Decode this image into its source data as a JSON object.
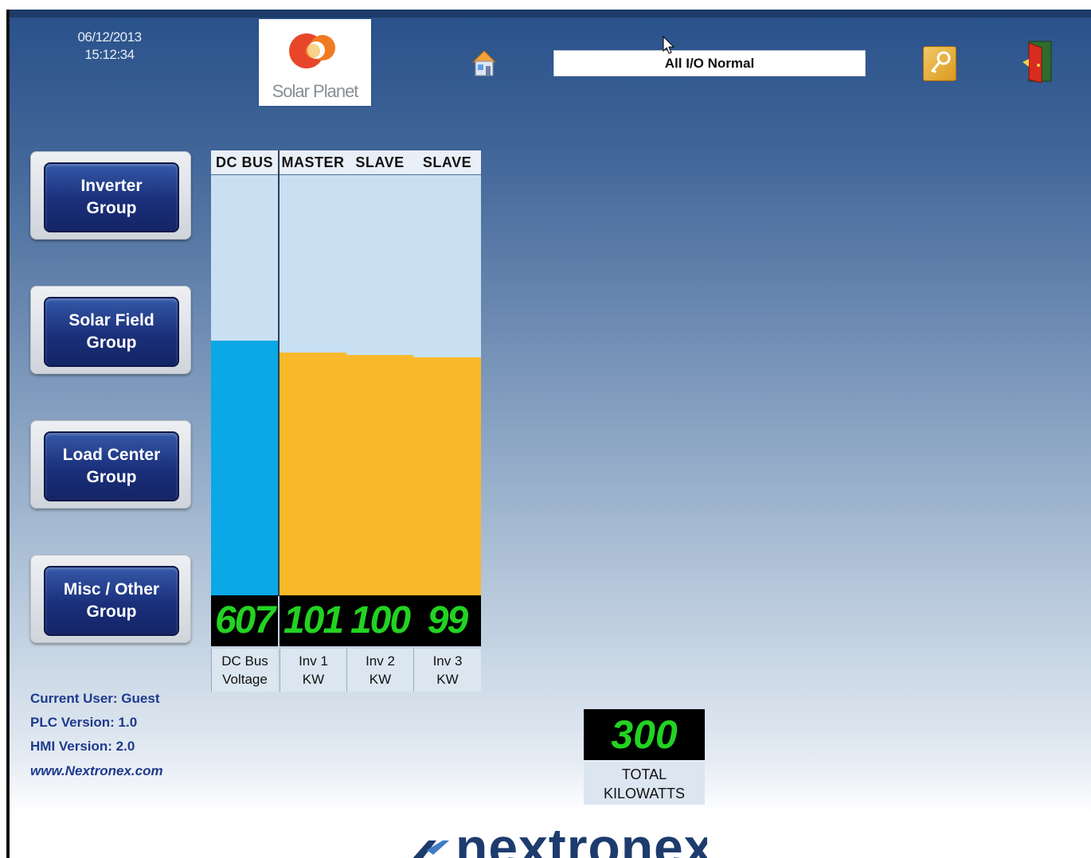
{
  "header": {
    "date": "06/12/2013",
    "time": "15:12:34",
    "logo_text": "Solar Planet",
    "status": "All I/O Normal"
  },
  "nav": [
    {
      "label": "Inverter\nGroup"
    },
    {
      "label": "Solar Field\nGroup"
    },
    {
      "label": "Load Center\nGroup"
    },
    {
      "label": "Misc / Other\nGroup"
    }
  ],
  "bars": {
    "headers": [
      "DC BUS",
      "MASTER",
      "SLAVE",
      "SLAVE"
    ],
    "items": [
      {
        "value": "607",
        "label": "DC Bus\nVoltage",
        "fill_fraction": 0.607,
        "color": "#0aa8e6"
      },
      {
        "value": "101",
        "label": "Inv 1\nKW",
        "fill_fraction": 0.577,
        "color": "#f8b82a"
      },
      {
        "value": "100",
        "label": "Inv 2\nKW",
        "fill_fraction": 0.572,
        "color": "#f8b82a"
      },
      {
        "value": "99",
        "label": "Inv 3\nKW",
        "fill_fraction": 0.566,
        "color": "#f8b82a"
      }
    ]
  },
  "info": {
    "user": "Current User: Guest",
    "plc": "PLC Version: 1.0",
    "hmi": "HMI Version: 2.0",
    "website": "www.Nextronex.com"
  },
  "total": {
    "value": "300",
    "label": "TOTAL\nKILOWATTS"
  },
  "footer": {
    "brand": "nextronex"
  }
}
